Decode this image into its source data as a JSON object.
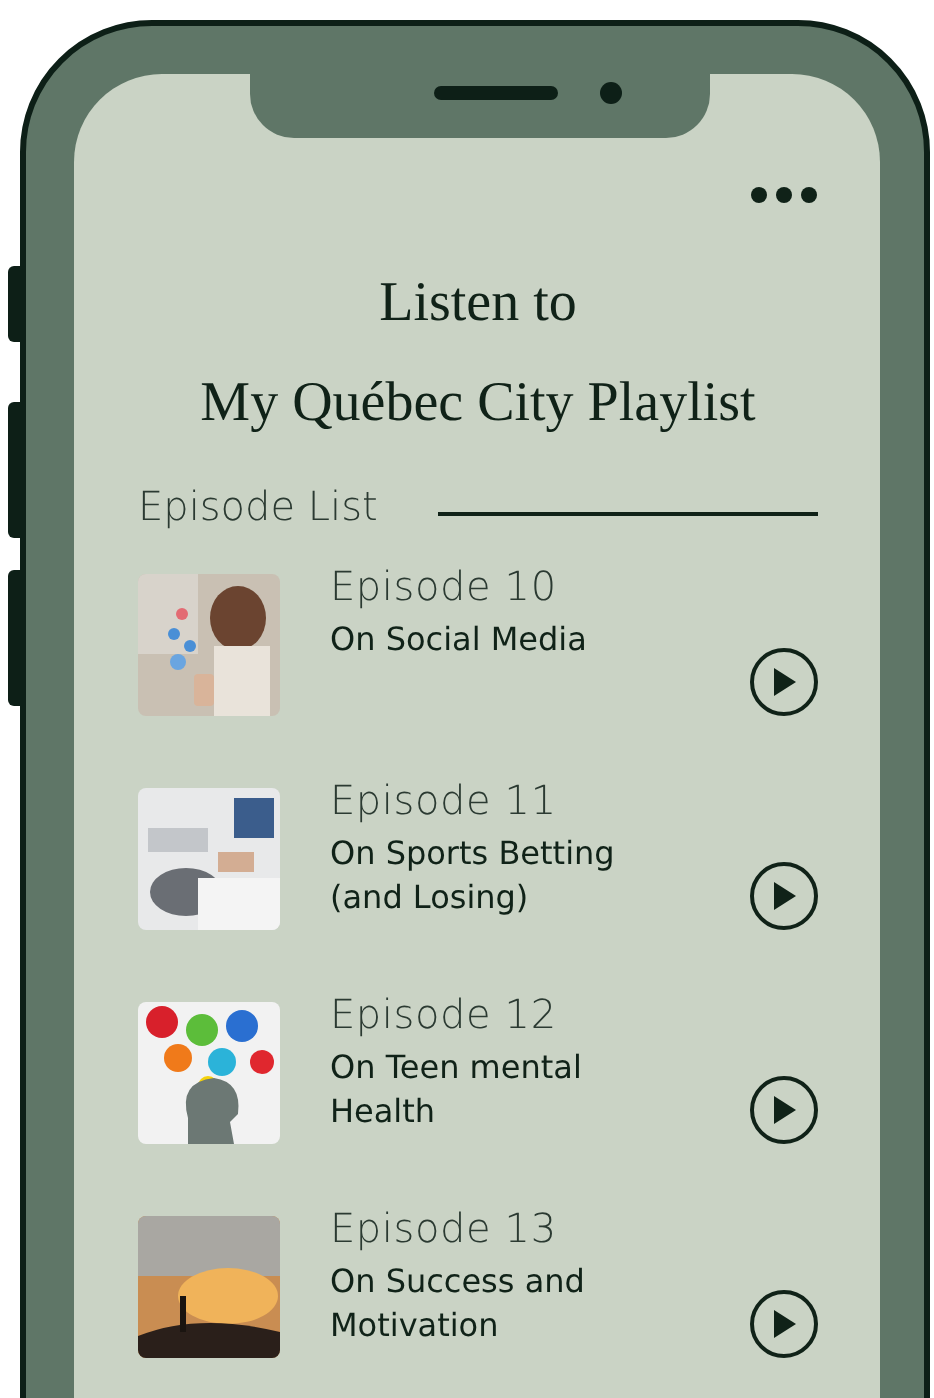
{
  "title_lines": [
    "Listen to",
    "My Québec City Playlist"
  ],
  "section_label": "Episode List",
  "episodes": [
    {
      "number": "Episode 10",
      "title": "On Social Media"
    },
    {
      "number": "Episode 11",
      "title": "On Sports Betting (and Losing)"
    },
    {
      "number": "Episode 12",
      "title": "On Teen mental Health"
    },
    {
      "number": "Episode 13",
      "title": "On Success and Motivation"
    }
  ]
}
